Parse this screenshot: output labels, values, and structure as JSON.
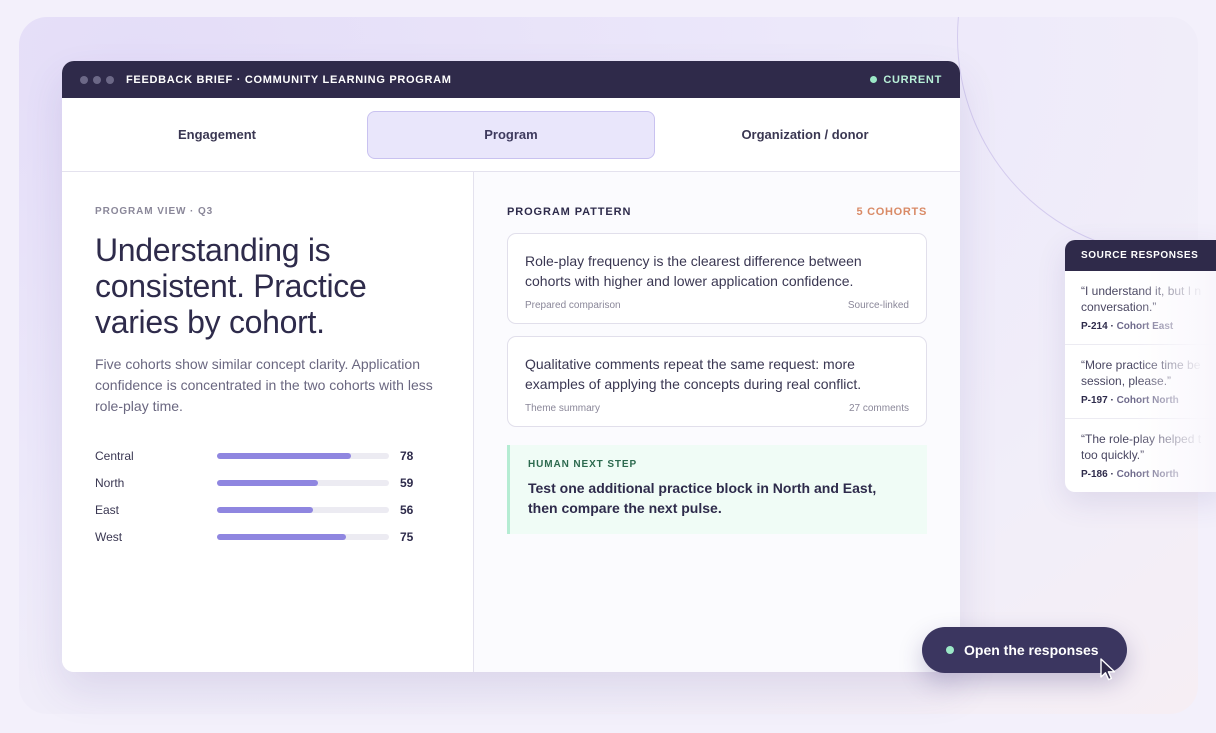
{
  "window": {
    "title": "FEEDBACK BRIEF · COMMUNITY LEARNING PROGRAM",
    "status": "CURRENT"
  },
  "tabs": [
    {
      "label": "Engagement",
      "active": false
    },
    {
      "label": "Program",
      "active": true
    },
    {
      "label": "Organization / donor",
      "active": false
    }
  ],
  "left": {
    "eyebrow": "PROGRAM VIEW · Q3",
    "headline_lines": [
      "Understanding is",
      "consistent. Practice",
      "varies by cohort."
    ],
    "description": "Five cohorts show similar concept clarity. Application confidence is concentrated in the two cohorts with less role-play time.",
    "bars": [
      {
        "label": "Central",
        "value": 78
      },
      {
        "label": "North",
        "value": 59
      },
      {
        "label": "East",
        "value": 56
      },
      {
        "label": "West",
        "value": 75
      }
    ]
  },
  "right": {
    "eyebrow": "PROGRAM PATTERN",
    "count": "5 COHORTS",
    "cards": [
      {
        "text": "Role-play frequency is the clearest difference between cohorts with higher and lower application confidence.",
        "meta_left": "Prepared comparison",
        "meta_right": "Source-linked"
      },
      {
        "text": "Qualitative comments repeat the same request: more examples of applying the concepts during real conflict.",
        "meta_left": "Theme summary",
        "meta_right": "27 comments"
      }
    ],
    "next_step": {
      "eyebrow": "HUMAN NEXT STEP",
      "text": "Test one additional practice block in North and East, then compare the next pulse."
    }
  },
  "source": {
    "title": "SOURCE RESPONSES",
    "quotes": [
      {
        "line1": "“I understand it, but I n",
        "line2": "conversation.”",
        "id": "P-214",
        "cohort": "Cohort East"
      },
      {
        "line1": "“More practice time be",
        "line2": "session, please.”",
        "id": "P-197",
        "cohort": "Cohort North"
      },
      {
        "line1": "“The role-play helped t",
        "line2": "too quickly.”",
        "id": "P-186",
        "cohort": "Cohort North"
      }
    ]
  },
  "cta": {
    "label": "Open the responses"
  },
  "colors": {
    "accent": "#8f86e0",
    "dark": "#2f2a4a",
    "success": "#9be8c7",
    "warm": "#d98a66"
  }
}
